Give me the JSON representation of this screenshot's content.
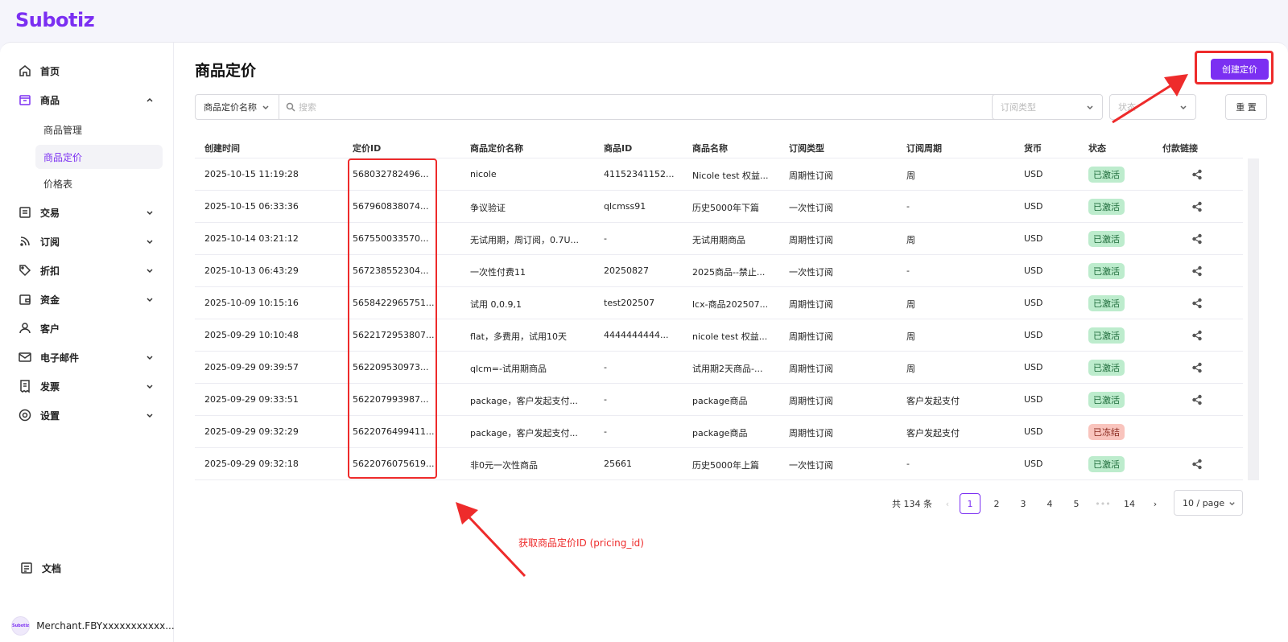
{
  "app": {
    "logo": "Subotiz"
  },
  "sidebar": {
    "items": [
      {
        "label": "首页",
        "icon": "home-icon"
      },
      {
        "label": "商品",
        "icon": "box-icon",
        "expanded": true,
        "children": [
          {
            "label": "商品管理"
          },
          {
            "label": "商品定价",
            "active": true
          },
          {
            "label": "价格表"
          }
        ]
      },
      {
        "label": "交易",
        "icon": "receipt-icon"
      },
      {
        "label": "订阅",
        "icon": "rss-icon"
      },
      {
        "label": "折扣",
        "icon": "tag-icon"
      },
      {
        "label": "资金",
        "icon": "wallet-icon"
      },
      {
        "label": "客户",
        "icon": "user-icon"
      },
      {
        "label": "电子邮件",
        "icon": "mail-icon"
      },
      {
        "label": "发票",
        "icon": "invoice-icon"
      },
      {
        "label": "设置",
        "icon": "gear-icon"
      }
    ],
    "docs": {
      "label": "文档",
      "icon": "docs-icon"
    },
    "merchant": {
      "avatar_text": "Subotiz",
      "name": "Merchant.FBYxxxxxxxxxxx..."
    }
  },
  "main": {
    "title": "商品定价",
    "create_button": "创建定价",
    "search": {
      "field": "商品定价名称",
      "placeholder": "搜索"
    },
    "filters": [
      {
        "placeholder": "订阅类型"
      },
      {
        "placeholder": "状态"
      }
    ],
    "reset_button": "重 置",
    "table": {
      "columns": [
        "创建时间",
        "定价ID",
        "商品定价名称",
        "商品ID",
        "商品名称",
        "订阅类型",
        "订阅周期",
        "货币",
        "状态",
        "付款链接"
      ],
      "rows": [
        [
          "2025-10-15 11:19:28",
          "568032782496...",
          "nicole",
          "41152341152...",
          "Nicole test 权益...",
          "周期性订阅",
          "周",
          "USD",
          "已激活",
          true
        ],
        [
          "2025-10-15 06:33:36",
          "567960838074...",
          "争议验证",
          "qlcmss91",
          "历史5000年下篇",
          "一次性订阅",
          "-",
          "USD",
          "已激活",
          true
        ],
        [
          "2025-10-14 03:21:12",
          "567550033570...",
          "无试用期，周订阅，0.7U...",
          "-",
          "无试用期商品",
          "周期性订阅",
          "周",
          "USD",
          "已激活",
          true
        ],
        [
          "2025-10-13 06:43:29",
          "567238552304...",
          "一次性付费11",
          "20250827",
          "2025商品--禁止...",
          "一次性订阅",
          "-",
          "USD",
          "已激活",
          true
        ],
        [
          "2025-10-09 10:15:16",
          "5658422965751...",
          "试用 0,0.9,1",
          "test202507",
          "lcx-商品202507...",
          "周期性订阅",
          "周",
          "USD",
          "已激活",
          true
        ],
        [
          "2025-09-29 10:10:48",
          "5622172953807...",
          "flat，多费用，试用10天",
          "4444444444...",
          "nicole test 权益...",
          "周期性订阅",
          "周",
          "USD",
          "已激活",
          true
        ],
        [
          "2025-09-29 09:39:57",
          "562209530973...",
          "qlcm=-试用期商品",
          "-",
          "试用期2天商品-...",
          "周期性订阅",
          "周",
          "USD",
          "已激活",
          true
        ],
        [
          "2025-09-29 09:33:51",
          "562207993987...",
          "package，客户发起支付...",
          "-",
          "package商品",
          "周期性订阅",
          "客户发起支付",
          "USD",
          "已激活",
          true
        ],
        [
          "2025-09-29 09:32:29",
          "5622076499411...",
          "package，客户发起支付...",
          "-",
          "package商品",
          "周期性订阅",
          "客户发起支付",
          "USD",
          "已冻结",
          false
        ],
        [
          "2025-09-29 09:32:18",
          "5622076075619...",
          "非0元一次性商品",
          "25661",
          "历史5000年上篇",
          "一次性订阅",
          "-",
          "USD",
          "已激活",
          true
        ]
      ]
    },
    "pagination": {
      "total": "共 134 条",
      "pages": [
        "1",
        "2",
        "3",
        "4",
        "5",
        "•••",
        "14"
      ],
      "current": "1",
      "page_size": "10 / page"
    },
    "annotation": "获取商品定价ID (pricing_id)"
  },
  "colors": {
    "accent": "#7b2ff2",
    "annotation": "#ee2b2b",
    "active_badge": "#bdeccd",
    "frozen_badge": "#f9c4bd"
  }
}
